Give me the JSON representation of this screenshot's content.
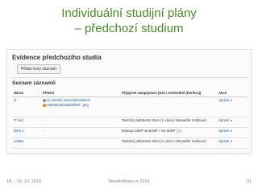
{
  "slide": {
    "title_line1": "Individuální studijní plány",
    "title_line2": "– předchozí studium"
  },
  "moodle": {
    "module_title": "Evidence předchozího studia",
    "add_button": "Přidat nový záznam",
    "section_title": "Seznam záznamů",
    "columns": [
      "Název",
      "Přílohé",
      "Příjoprné zamprjatace (Uás / Hodnotitel (Deribor))",
      "Akcé"
    ],
    "rows": [
      {
        "name": "IT",
        "attachments": [
          "oo interdiv ascricrtiefoselseet",
          "2B2btebarb23Bd9hB4...png"
        ],
        "note": "",
        "action": "Upravit"
      },
      {
        "name": "IT esd",
        "attachments": [
          "-"
        ],
        "note": "Tesločný pobrtestor Irlorn (V vároo / Moreatřer Veldnour)",
        "action": "Upravit"
      },
      {
        "name": "klerk 1",
        "attachments": [
          "-"
        ],
        "note": "Makcup SKEP amrpnell + Ne SKEP ( ) )",
        "action": "Upravit"
      },
      {
        "name": "nastka",
        "attachments": [
          "-"
        ],
        "note": "Tesločný pobrtestor Irlorn (V vároo / Moreatřer Veldnour)",
        "action": "Upravit"
      }
    ],
    "colors": {
      "link": "#1a5a99",
      "title_green": "#4a8a2a"
    }
  },
  "footer": {
    "date": "18. - 19. 10. 2016",
    "event": "MoodleMoot.cz 2016",
    "page": "31"
  }
}
